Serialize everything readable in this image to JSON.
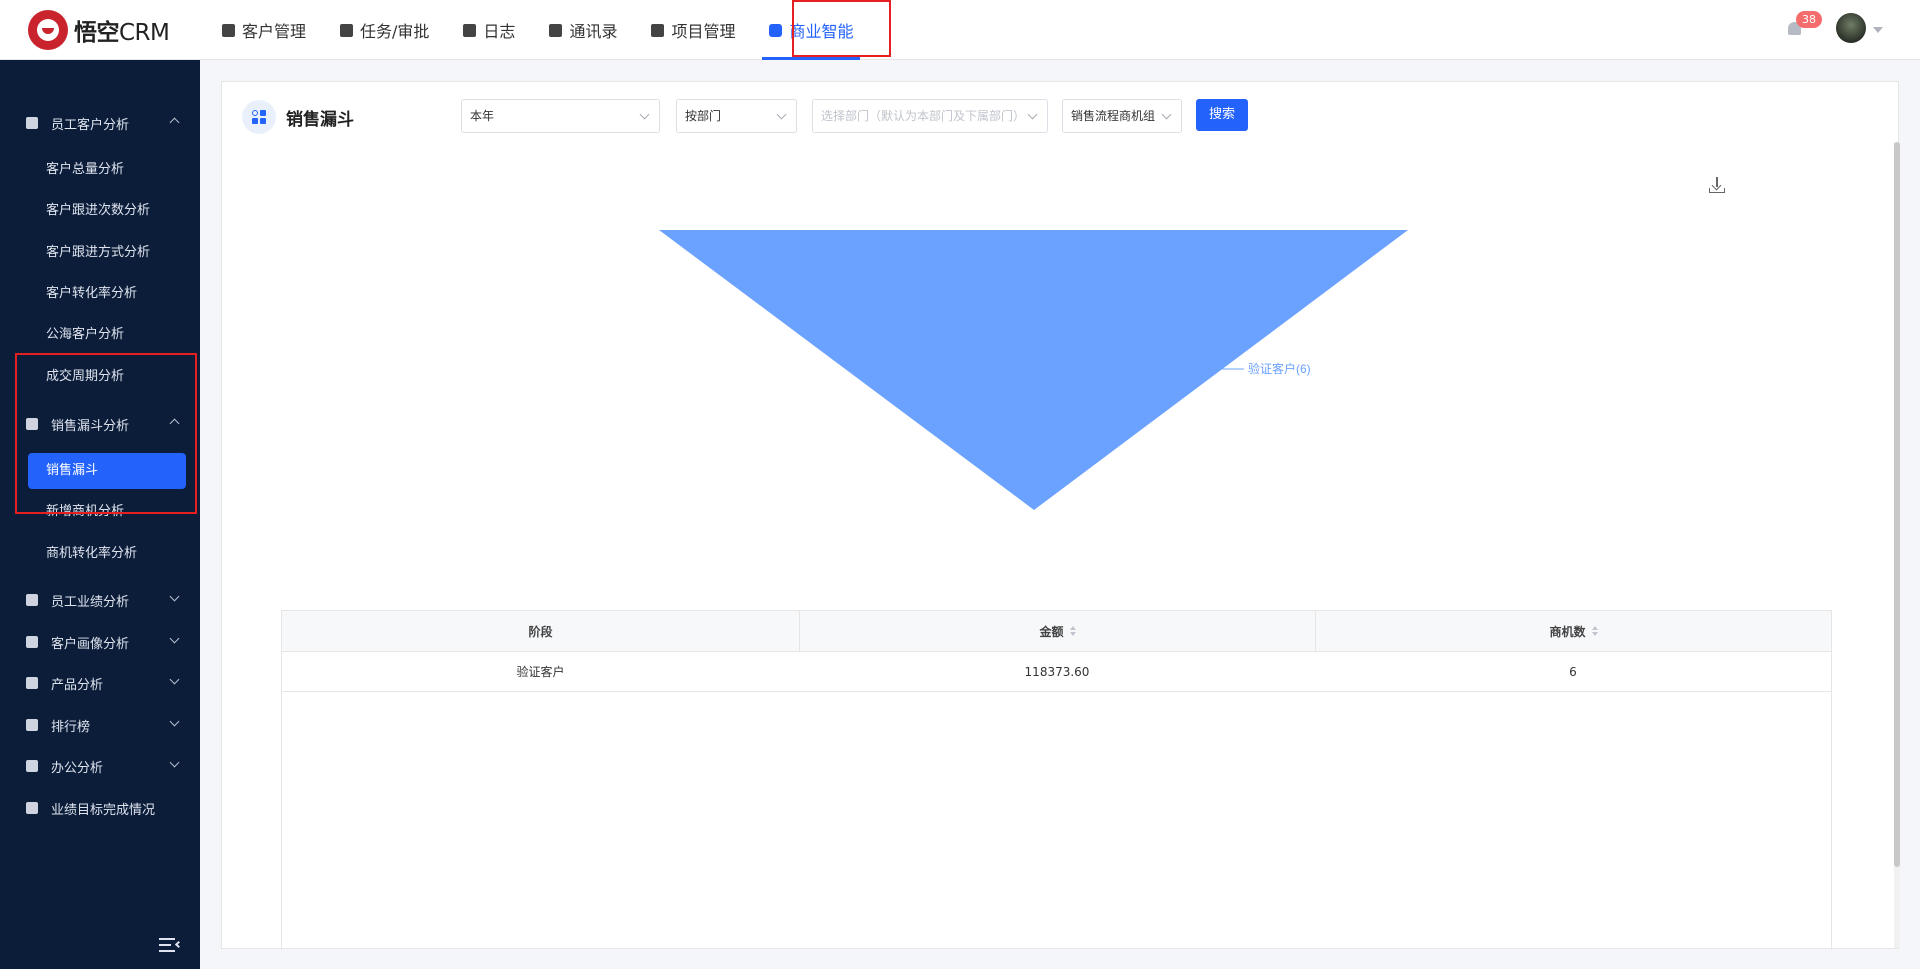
{
  "app": {
    "logo_name": "悟空",
    "logo_suffix": "CRM"
  },
  "nav": [
    {
      "label": "客户管理",
      "icon": "building-icon"
    },
    {
      "label": "任务/审批",
      "icon": "briefcase-icon"
    },
    {
      "label": "日志",
      "icon": "notebook-icon"
    },
    {
      "label": "通讯录",
      "icon": "phone-book-icon"
    },
    {
      "label": "项目管理",
      "icon": "kanban-icon"
    },
    {
      "label": "商业智能",
      "icon": "shield-check-icon",
      "active": true
    }
  ],
  "header": {
    "notification_count": "38"
  },
  "sidebar": {
    "groups": [
      {
        "label": "员工客户分析",
        "icon": "user-icon",
        "expanded": true,
        "items": [
          "客户总量分析",
          "客户跟进次数分析",
          "客户跟进方式分析",
          "客户转化率分析",
          "公海客户分析",
          "成交周期分析"
        ]
      },
      {
        "label": "销售漏斗分析",
        "icon": "funnel-icon",
        "expanded": true,
        "items": [
          "销售漏斗",
          "新增商机分析",
          "商机转化率分析"
        ],
        "active_item": "销售漏斗"
      },
      {
        "label": "员工业绩分析",
        "icon": "bar-chart-icon",
        "expanded": false
      },
      {
        "label": "客户画像分析",
        "icon": "users-icon",
        "expanded": false
      },
      {
        "label": "产品分析",
        "icon": "box-icon",
        "expanded": false
      },
      {
        "label": "排行榜",
        "icon": "trophy-icon",
        "expanded": false
      },
      {
        "label": "办公分析",
        "icon": "briefcase-icon",
        "expanded": false
      },
      {
        "label": "业绩目标完成情况",
        "icon": "target-icon",
        "expanded": false
      }
    ]
  },
  "page": {
    "title": "销售漏斗",
    "filters": {
      "period": "本年",
      "scope": "按部门",
      "department_placeholder": "选择部门（默认为本部门及下属部门）",
      "process": "销售流程商机组"
    },
    "search_label": "搜索"
  },
  "chart_data": {
    "type": "funnel",
    "stages": [
      {
        "name": "验证客户",
        "count": 6
      }
    ],
    "label": "验证客户(6)",
    "color": "#6ca2ff"
  },
  "table": {
    "columns": [
      "阶段",
      "金额",
      "商机数"
    ],
    "rows": [
      [
        "验证客户",
        "118373.60",
        "6"
      ]
    ]
  }
}
